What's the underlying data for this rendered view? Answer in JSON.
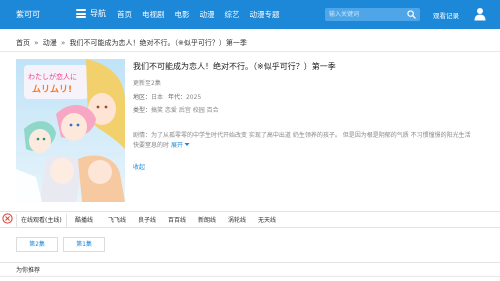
{
  "header": {
    "logo": "紫可可",
    "nav_label": "导航",
    "links": [
      "首页",
      "电视剧",
      "电影",
      "动漫",
      "综艺",
      "动漫专题"
    ],
    "search_placeholder": "输入关键词",
    "history_label": "观看记录",
    "accent": "#1e88d8"
  },
  "breadcrumb": {
    "items": [
      "首页",
      "动漫",
      "我们不可能成为恋人！绝对不行。（※似乎可行？）第一季"
    ],
    "separator": "»"
  },
  "detail": {
    "title": "我们不可能成为恋人！绝对不行。（※似乎可行？）第一季",
    "update": "更新至2集",
    "region_label": "地区：",
    "region": "日本",
    "year_label": "年代：",
    "year": "2025",
    "type_label": "类型：",
    "type": "搞笑 恋爱 后宫 校园 百合",
    "desc_label": "剧情：",
    "description": "为了从孤零零的中学生时代开始改变 实现了高中出道 奶生领养的孩子。 但是因为根是阴郁的气质 不习惯憧憬的阳光生活 快要窒息的时",
    "expand_label": "展开",
    "collapse_label": "收起",
    "poster_text": "わたしが恋人になれるわけないじゃん ムリムリ！"
  },
  "sources": {
    "tabs": [
      "在线观看(主线)",
      "酷播线",
      "飞飞线",
      "良子线",
      "百百线",
      "新朗线",
      "涡轮线",
      "无天线"
    ],
    "active_index": 0
  },
  "episodes": [
    "第2集",
    "第1集"
  ],
  "recommend": {
    "label": "为你推荐"
  }
}
